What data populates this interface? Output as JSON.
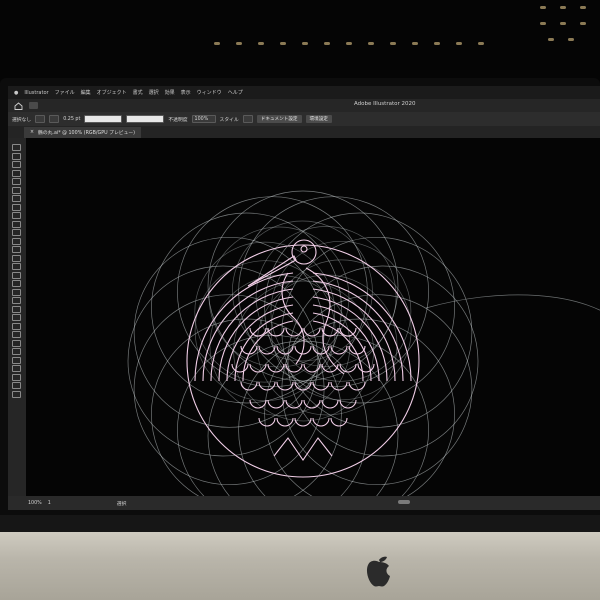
{
  "app": {
    "window_title": "Adobe Illustrator 2020",
    "menu": [
      "Illustrator",
      "ファイル",
      "編集",
      "オブジェクト",
      "書式",
      "選択",
      "効果",
      "表示",
      "ウィンドウ",
      "ヘルプ"
    ]
  },
  "control_bar": {
    "selection_label": "選択なし",
    "stroke_weight": "0.25 pt",
    "opacity_label": "不透明度",
    "opacity_value": "100%",
    "style_label": "スタイル",
    "doc_setup_button": "ドキュメント設定",
    "preferences_button": "環境設定"
  },
  "document_tab": {
    "close_glyph": "×",
    "label": "鶴の丸.ai* @ 100% (RGB/GPU プレビュー)"
  },
  "status_bar": {
    "zoom": "100%",
    "page": "1",
    "mode": "選択"
  },
  "colors": {
    "artwork_guides": "#cfd7d9",
    "artwork_crest": "#f2cfe8",
    "ui_panel": "#2d2d2d"
  },
  "icons": [
    "apple-logo-icon",
    "home-icon",
    "close-icon"
  ]
}
